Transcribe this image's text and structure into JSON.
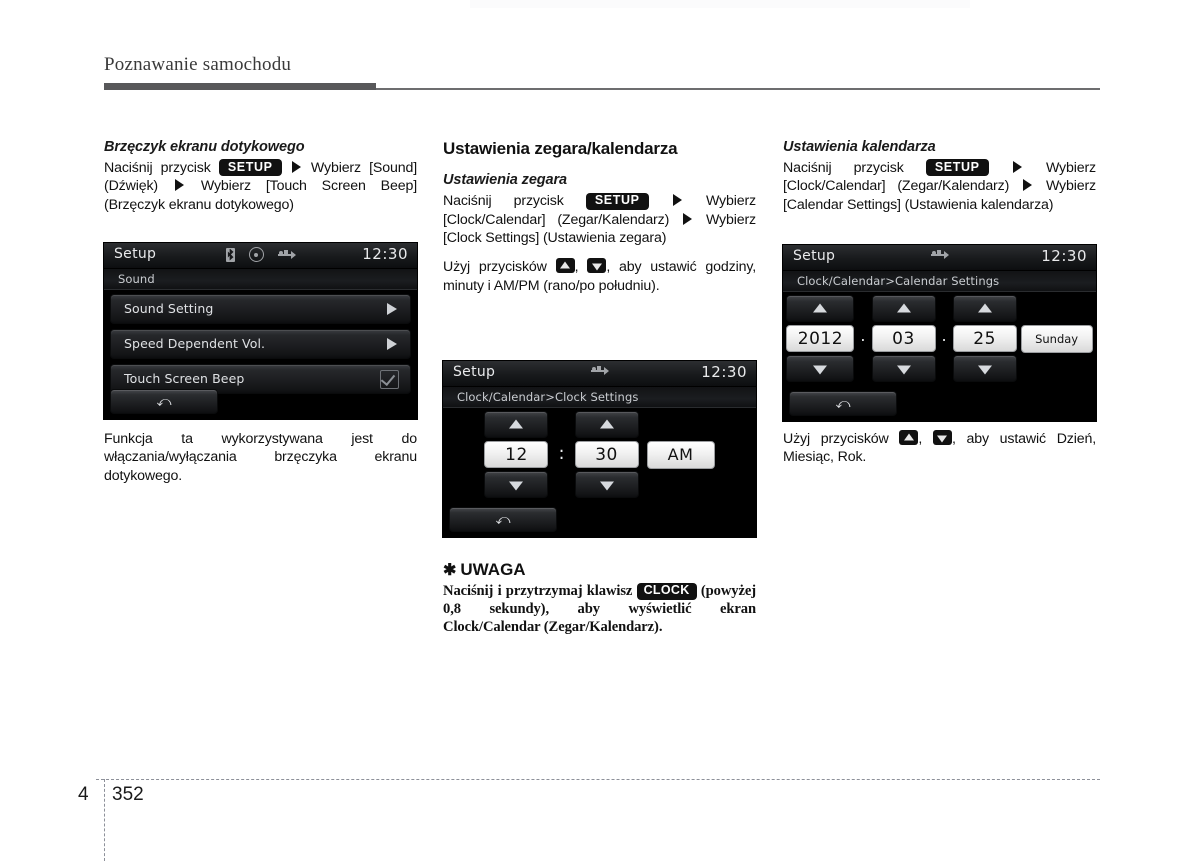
{
  "header": {
    "title": "Poznawanie samochodu"
  },
  "footer": {
    "chapter": "4",
    "page": "352"
  },
  "left_column": {
    "heading": "Brzęczyk ekranu dotykowego",
    "instruction_prefix": "Naciśnij przycisk",
    "setup_chip": "SETUP",
    "instruction_mid": "Wybierz [Sound] (Dźwięk)",
    "instruction_tail": "Wybierz [Touch Screen Beep] (Brzęczyk ekranu dotykowego)",
    "description": "Funkcja ta wykorzystywana jest do włączania/wyłączania brzęczyka ekranu dotykowego."
  },
  "middle_column": {
    "heading": "Ustawienia zegara/kalendarza",
    "subheading": "Ustawienia zegara",
    "instruction_prefix": "Naciśnij przycisk",
    "setup_chip": "SETUP",
    "instruction_mid": "Wybierz [Clock/Calendar] (Zegar/Kalendarz)",
    "instruction_tail": "Wybierz [Clock Settings] (Ustawienia zegara)",
    "buttons_prefix": "Użyj przycisków",
    "buttons_tail": ", aby ustawić godziny, minuty i AM/PM (rano/po południu).",
    "note": {
      "star": "✱",
      "title": "UWAGA",
      "text_1": "Naciśnij i przytrzymaj klawisz",
      "clock_chip": "CLOCK",
      "text_2": "(powyżej 0,8 sekundy), aby wyświetlić ekran Clock/Calendar (Zegar/Kalendarz)."
    }
  },
  "right_column": {
    "subheading": "Ustawienia kalendarza",
    "instruction_prefix": "Naciśnij przycisk",
    "setup_chip": "SETUP",
    "instruction_mid": "Wybierz [Clock/Calendar] (Zegar/Kalendarz)",
    "instruction_tail": "Wybierz [Calendar Settings] (Ustawienia kalendarza)",
    "buttons_prefix": "Użyj przycisków",
    "buttons_tail": ", aby ustawić Dzień, Miesiąc, Rok."
  },
  "screen_sound": {
    "title": "Setup",
    "clock": "12:30",
    "status_icons": [
      "bluetooth-icon",
      "disc-icon",
      "usb-icon"
    ],
    "breadcrumb": "Sound",
    "rows": [
      {
        "label": "Sound Setting",
        "control": "arrow"
      },
      {
        "label": "Speed Dependent Vol.",
        "control": "arrow"
      },
      {
        "label": "Touch Screen Beep",
        "control": "check"
      }
    ],
    "back_glyph": "⤺"
  },
  "screen_clock": {
    "title": "Setup",
    "clock": "12:30",
    "status_icons": [
      "usb-icon"
    ],
    "breadcrumb": "Clock/Calendar>Clock Settings",
    "hour": "12",
    "separator": ":",
    "minute": "30",
    "meridiem": "AM",
    "back_glyph": "⤺"
  },
  "screen_calendar": {
    "title": "Setup",
    "clock": "12:30",
    "status_icons": [
      "usb-icon"
    ],
    "breadcrumb": "Clock/Calendar>Calendar Settings",
    "year": "2012",
    "dot_1": ".",
    "month": "03",
    "dot_2": ".",
    "day": "25",
    "weekday": "Sunday",
    "back_glyph": "⤺"
  },
  "colors": {
    "rule": "#58585a",
    "text": "#111111",
    "screen_bg": "#000000",
    "screen_text": "#e9eaec",
    "value_bg": "#f1f1f1"
  }
}
